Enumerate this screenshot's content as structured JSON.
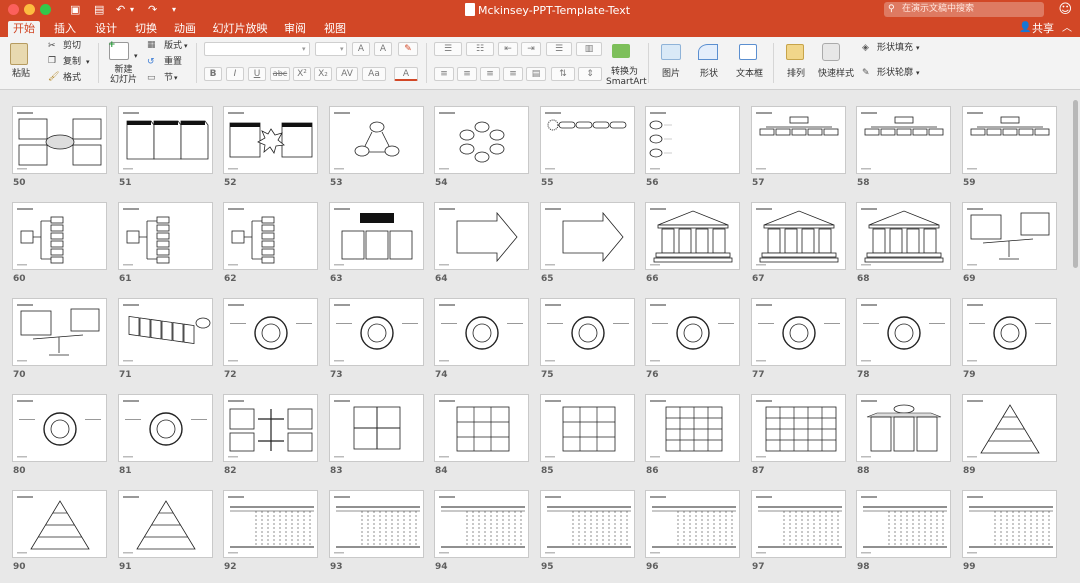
{
  "window": {
    "title": "Mckinsey-PPT-Template-Text",
    "search_placeholder": "在演示文稿中搜索",
    "share_label": "共享"
  },
  "tabs": [
    "开始",
    "插入",
    "设计",
    "切换",
    "动画",
    "幻灯片放映",
    "审阅",
    "视图"
  ],
  "ribbon": {
    "paste": "粘贴",
    "cut": "剪切",
    "copy": "复制",
    "format": "格式",
    "new_slide": "新建\n幻灯片",
    "layout": "版式",
    "reset": "重置",
    "section": "节",
    "font_grow": "A",
    "font_shrink": "A",
    "bold": "B",
    "italic": "I",
    "underline": "U",
    "strike": "abc",
    "superscript": "X²",
    "subscript": "X₂",
    "char_spacing": "AV",
    "change_case": "Aa",
    "font_color": "A",
    "convert": "转换为",
    "smartart": "SmartArt",
    "picture": "图片",
    "shape": "形状",
    "textbox": "文本框",
    "arrange": "排列",
    "quick_styles": "快速样式",
    "shape_fill": "形状填充",
    "shape_outline": "形状轮廓"
  },
  "slide_numbers": [
    "50",
    "51",
    "52",
    "53",
    "54",
    "55",
    "56",
    "57",
    "58",
    "59",
    "60",
    "61",
    "62",
    "63",
    "64",
    "65",
    "66",
    "67",
    "68",
    "69",
    "70",
    "71",
    "72",
    "73",
    "74",
    "75",
    "76",
    "77",
    "78",
    "79",
    "80",
    "81",
    "82",
    "83",
    "84",
    "85",
    "86",
    "87",
    "88",
    "89",
    "90",
    "91",
    "92",
    "93",
    "94",
    "95",
    "96",
    "97",
    "98",
    "99"
  ],
  "slide_types": [
    "hub",
    "steps3",
    "burst",
    "cycle3",
    "ring6",
    "arrowrow",
    "ovals",
    "tree",
    "tree",
    "tree",
    "bracket",
    "bracket",
    "bracket",
    "columns3",
    "arrowbig",
    "arrowbig",
    "temple",
    "temple",
    "temple",
    "scale",
    "scale",
    "chain",
    "cycle",
    "cycle",
    "cycle",
    "cycle",
    "cycle",
    "cycle",
    "cycle",
    "cycle",
    "cycle",
    "cycle",
    "crossarrows",
    "matrix2",
    "matrix3",
    "matrix3",
    "matrix4",
    "matrix5",
    "columns3b",
    "pyramid",
    "pyramid",
    "pyramid",
    "table",
    "table",
    "table",
    "table",
    "table",
    "table",
    "table",
    "table"
  ],
  "colors": {
    "brand": "#d24726",
    "tab_active_text": "#d24726"
  },
  "icons": [
    "apple-close",
    "cut-icon",
    "copy-icon",
    "format-painter-icon",
    "new-slide-icon",
    "picture-icon",
    "shape-icon",
    "textbox-icon",
    "arrange-icon",
    "quick-styles-icon",
    "smiley-icon",
    "search-icon"
  ]
}
